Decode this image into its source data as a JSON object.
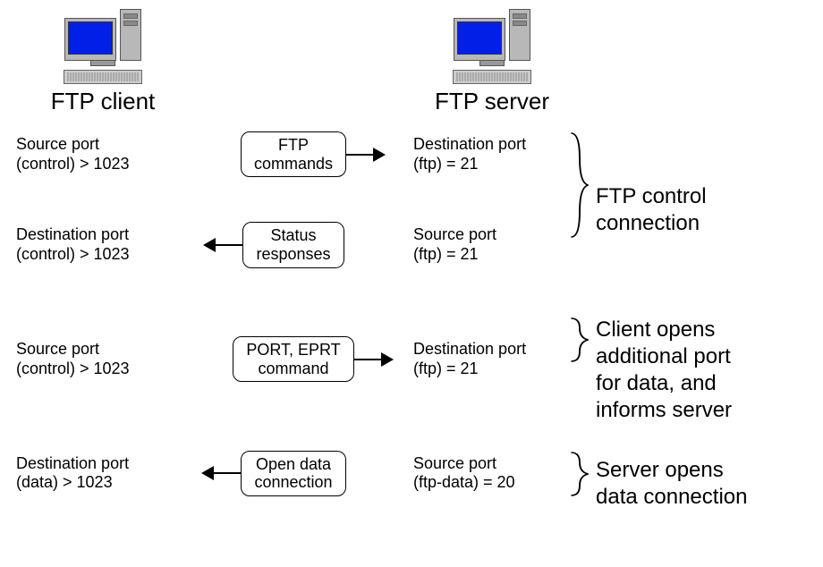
{
  "header": {
    "client": "FTP client",
    "server": "FTP server"
  },
  "groups": [
    {
      "rows": [
        {
          "client": "Source port\n(control) > 1023",
          "msg": "FTP\ncommands",
          "dir": "right",
          "server": "Destination port\n(ftp) = 21"
        },
        {
          "client": "Destination port\n(control) > 1023",
          "msg": "Status\nresponses",
          "dir": "left",
          "server": "Source port\n(ftp) = 21"
        }
      ],
      "annot": "FTP control\nconnection"
    },
    {
      "rows": [
        {
          "client": "Source port\n(control) > 1023",
          "msg": "PORT, EPRT\ncommand",
          "dir": "right",
          "server": "Destination port\n(ftp) = 21"
        }
      ],
      "annot": "Client opens\nadditional port\nfor data, and\ninforms server"
    },
    {
      "rows": [
        {
          "client": "Destination port\n(data) > 1023",
          "msg": "Open data\nconnection",
          "dir": "left",
          "server": "Source port\n(ftp-data) = 20"
        }
      ],
      "annot": "Server opens\ndata connection"
    }
  ],
  "chart_data": {
    "type": "diagram",
    "protocol": "FTP",
    "nodes": [
      "FTP client",
      "FTP server"
    ],
    "flows": [
      {
        "from": "FTP client",
        "to": "FTP server",
        "label": "FTP commands",
        "client_port": "Source port (control) > 1023",
        "server_port": "Destination port (ftp) = 21",
        "group": "FTP control connection"
      },
      {
        "from": "FTP server",
        "to": "FTP client",
        "label": "Status responses",
        "client_port": "Destination port (control) > 1023",
        "server_port": "Source port (ftp) = 21",
        "group": "FTP control connection"
      },
      {
        "from": "FTP client",
        "to": "FTP server",
        "label": "PORT, EPRT command",
        "client_port": "Source port (control) > 1023",
        "server_port": "Destination port (ftp) = 21",
        "group": "Client opens additional port for data, and informs server"
      },
      {
        "from": "FTP server",
        "to": "FTP client",
        "label": "Open data connection",
        "client_port": "Destination port (data) > 1023",
        "server_port": "Source port (ftp-data) = 20",
        "group": "Server opens data connection"
      }
    ]
  }
}
